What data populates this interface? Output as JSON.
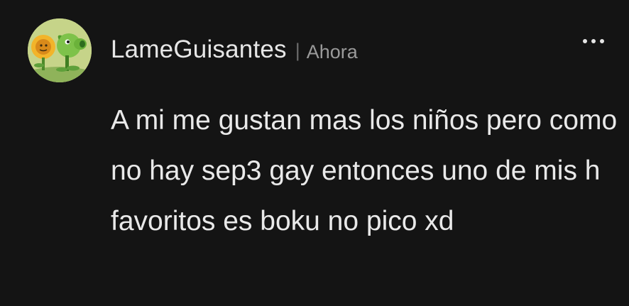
{
  "comment": {
    "username": "LameGuisantes",
    "separator": "|",
    "timestamp": "Ahora",
    "text": "A mi me gustan mas los niños pero como no hay sep3 gay entonces uno de mis h favoritos es boku no pico xd",
    "avatar_icon": "plant-avatar-icon",
    "more_icon": "more-options-icon"
  },
  "colors": {
    "background": "#141414",
    "text": "#e9e9e9",
    "muted": "#9a9a9a"
  }
}
